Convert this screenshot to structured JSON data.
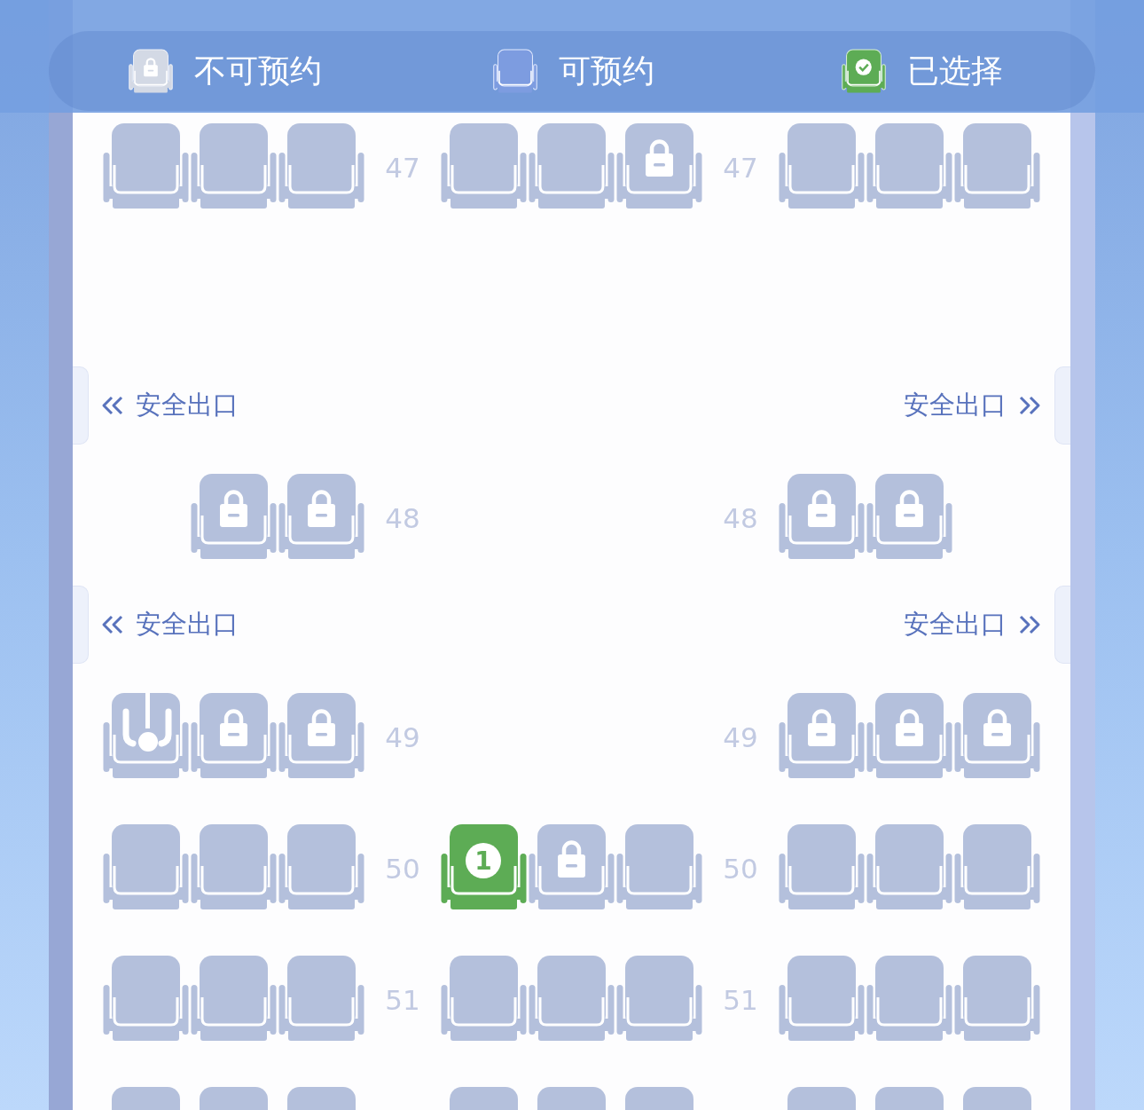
{
  "legend": [
    {
      "kind": "locked",
      "label": "不可预约"
    },
    {
      "kind": "available",
      "label": "可预约"
    },
    {
      "kind": "selected",
      "label": "已选择"
    }
  ],
  "rows": [
    {
      "kind": "seats",
      "labels": [
        "47",
        "47"
      ],
      "left": [
        {
          "kind": "available",
          "selected": false
        },
        {
          "kind": "available",
          "selected": false
        },
        {
          "kind": "available",
          "selected": false
        }
      ],
      "middle": [
        {
          "kind": "available",
          "selected": false
        },
        {
          "kind": "available",
          "selected": false
        },
        {
          "kind": "locked",
          "selected": false
        }
      ],
      "right": [
        {
          "kind": "available",
          "selected": false
        },
        {
          "kind": "available",
          "selected": false
        },
        {
          "kind": "available",
          "selected": false
        }
      ]
    },
    {
      "kind": "exit",
      "left": "安全出口",
      "right": "安全出口"
    },
    {
      "kind": "seats",
      "labels": [
        "48",
        "48"
      ],
      "left": [
        {
          "kind": "locked",
          "selected": false
        },
        {
          "kind": "locked",
          "selected": false
        }
      ],
      "right": [
        {
          "kind": "locked",
          "selected": false
        },
        {
          "kind": "locked",
          "selected": false
        }
      ]
    },
    {
      "kind": "exit",
      "left": "安全出口",
      "right": "安全出口"
    },
    {
      "kind": "seats",
      "labels": [
        "49",
        "49"
      ],
      "left": [
        {
          "kind": "special",
          "selected": false
        },
        {
          "kind": "locked",
          "selected": false
        },
        {
          "kind": "locked",
          "selected": false
        }
      ],
      "right": [
        {
          "kind": "locked",
          "selected": false
        },
        {
          "kind": "locked",
          "selected": false
        },
        {
          "kind": "locked",
          "selected": false
        }
      ]
    },
    {
      "kind": "seats",
      "labels": [
        "50",
        "50"
      ],
      "left": [
        {
          "kind": "available",
          "selected": false
        },
        {
          "kind": "available",
          "selected": false
        },
        {
          "kind": "available",
          "selected": false
        }
      ],
      "middle": [
        {
          "kind": "available",
          "selected": true,
          "number": "1"
        },
        {
          "kind": "locked",
          "selected": false
        },
        {
          "kind": "available",
          "selected": false
        }
      ],
      "right": [
        {
          "kind": "available",
          "selected": false
        },
        {
          "kind": "available",
          "selected": false
        },
        {
          "kind": "available",
          "selected": false
        }
      ]
    },
    {
      "kind": "seats",
      "labels": [
        "51",
        "51"
      ],
      "left": [
        {
          "kind": "available",
          "selected": false
        },
        {
          "kind": "available",
          "selected": false
        },
        {
          "kind": "available",
          "selected": false
        }
      ],
      "middle": [
        {
          "kind": "available",
          "selected": false
        },
        {
          "kind": "available",
          "selected": false
        },
        {
          "kind": "available",
          "selected": false
        }
      ],
      "right": [
        {
          "kind": "available",
          "selected": false
        },
        {
          "kind": "available",
          "selected": false
        },
        {
          "kind": "available",
          "selected": false
        }
      ]
    },
    {
      "kind": "seats",
      "left": [
        {
          "kind": "available",
          "selected": false
        },
        {
          "kind": "available",
          "selected": false
        },
        {
          "kind": "available",
          "selected": false
        }
      ],
      "middle": [
        {
          "kind": "available",
          "selected": false
        },
        {
          "kind": "available",
          "selected": false
        },
        {
          "kind": "available",
          "selected": false
        }
      ],
      "right": [
        {
          "kind": "available",
          "selected": false
        },
        {
          "kind": "available",
          "selected": false
        },
        {
          "kind": "available",
          "selected": false
        }
      ]
    }
  ]
}
